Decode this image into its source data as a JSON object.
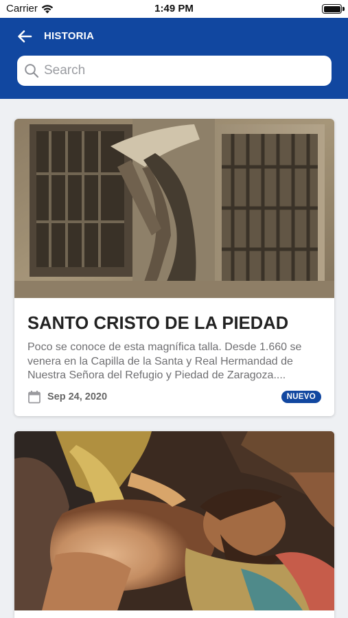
{
  "status_bar": {
    "carrier": "Carrier",
    "time": "1:49 PM",
    "battery_level_pct": 100
  },
  "header": {
    "title": "HISTORIA",
    "back_icon": "arrow-left-icon",
    "background_color": "#1147a0"
  },
  "search": {
    "placeholder": "Search",
    "value": "",
    "icon": "search-icon"
  },
  "articles": [
    {
      "title": "SANTO CRISTO DE LA PIEDAD",
      "excerpt": "Poco se conoce de esta magnífica talla. Desde 1.660 se venera en la Capilla de la Santa y Real Hermandad de Nuestra Señora del Refugio y Piedad de Zaragoza....",
      "date": "Sep 24, 2020",
      "badge": "NUEVO",
      "date_icon": "calendar-icon"
    },
    {
      "title": "",
      "excerpt": "",
      "date": "",
      "badge": ""
    }
  ],
  "colors": {
    "accent": "#1147a0",
    "page_background": "#eef0f3",
    "card_background": "#ffffff"
  }
}
